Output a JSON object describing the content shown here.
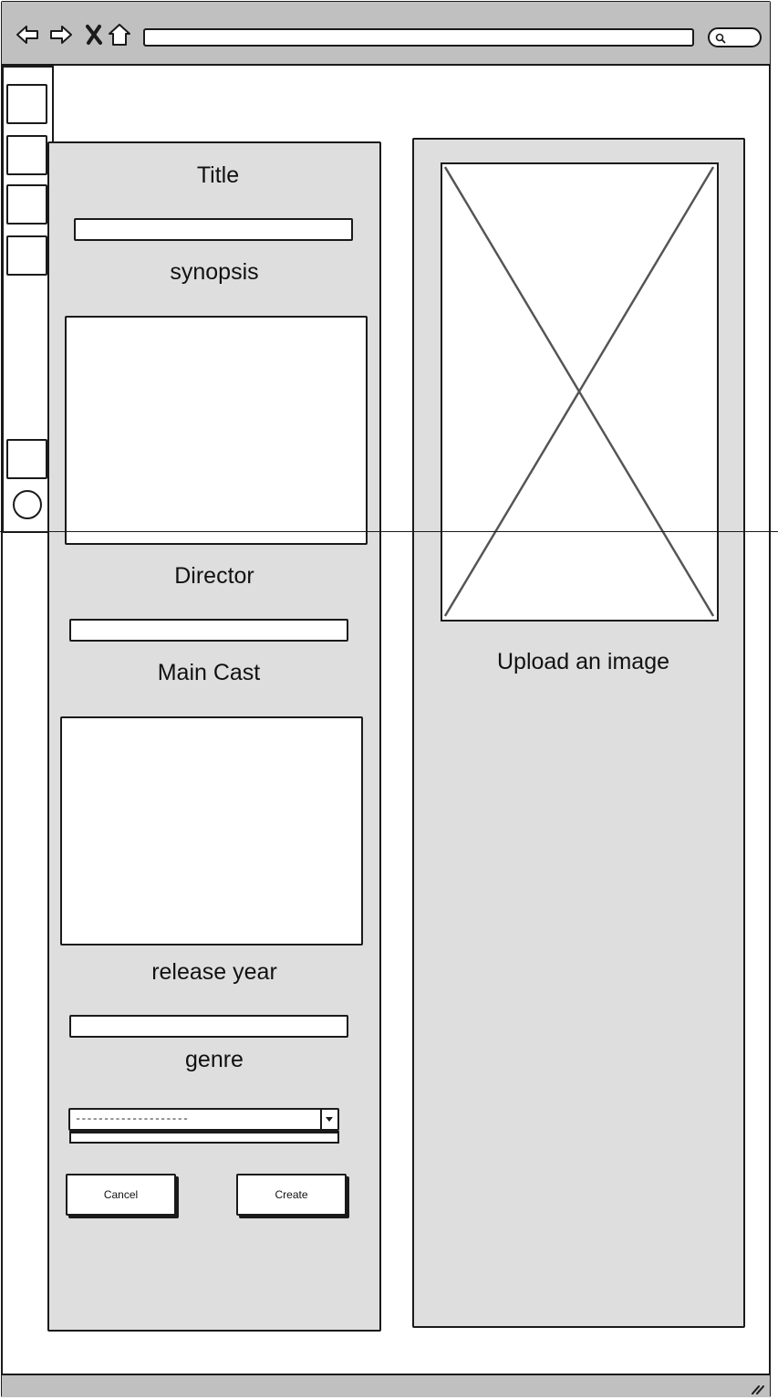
{
  "browser": {
    "icons": {
      "back": "back-arrow-icon",
      "forward": "forward-arrow-icon",
      "close": "close-x-icon",
      "home": "home-icon",
      "search": "search-icon"
    }
  },
  "form": {
    "title_label": "Title",
    "synopsis_label": "synopsis",
    "director_label": "Director",
    "main_cast_label": "Main Cast",
    "release_year_label": "release year",
    "genre_label": "genre",
    "genre_selected": "--------------------",
    "cancel_label": "Cancel",
    "create_label": "Create"
  },
  "image_panel": {
    "upload_label": "Upload an image"
  },
  "colors": {
    "chrome": "#c0c0c0",
    "panel": "#dedede",
    "stroke": "#1a1a1a"
  }
}
